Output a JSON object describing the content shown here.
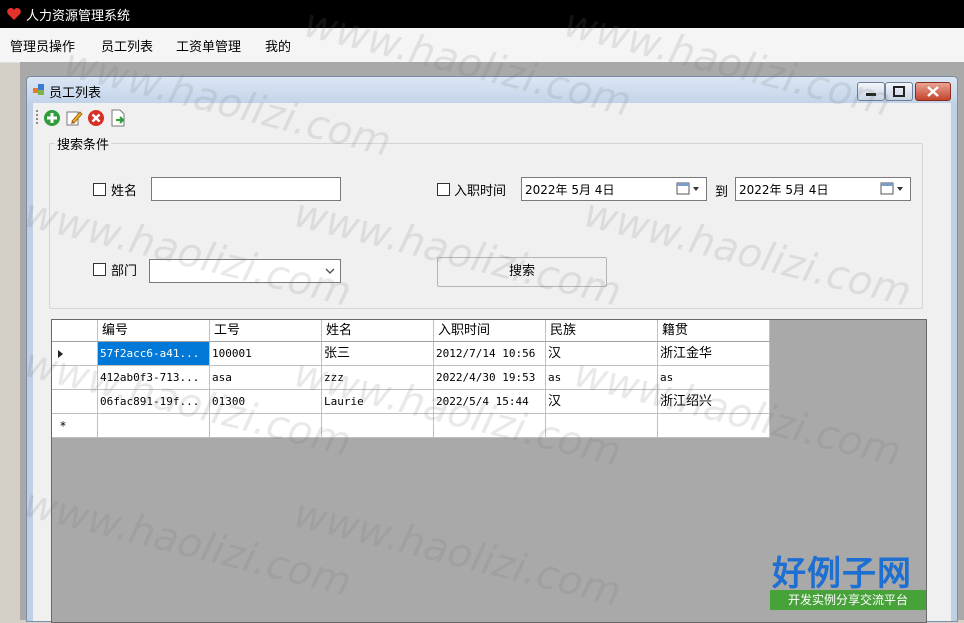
{
  "app": {
    "title": "人力资源管理系统"
  },
  "menu": {
    "items": [
      "管理员操作",
      "员工列表",
      "工资单管理",
      "我的"
    ]
  },
  "child_window": {
    "title": "员工列表"
  },
  "toolbar": {
    "icons": [
      "add-icon",
      "edit-icon",
      "delete-icon",
      "export-icon"
    ]
  },
  "search": {
    "legend": "搜索条件",
    "name_label": "姓名",
    "name_value": "",
    "hire_label": "入职时间",
    "hire_from": "2022年 5月 4日",
    "to_label": "到",
    "hire_to": "2022年 5月 4日",
    "dept_label": "部门",
    "dept_value": "",
    "button_label": "搜索"
  },
  "grid": {
    "columns": [
      "编号",
      "工号",
      "姓名",
      "入职时间",
      "民族",
      "籍贯"
    ],
    "rows": [
      [
        "57f2acc6-a41...",
        "100001",
        "张三",
        "2012/7/14 10:56",
        "汉",
        "浙江金华"
      ],
      [
        "412ab0f3-713...",
        "asa",
        "zzz",
        "2022/4/30 19:53",
        "as",
        "as"
      ],
      [
        "06fac891-19f...",
        "01300",
        "Laurie",
        "2022/5/4 15:44",
        "汉",
        "浙江绍兴"
      ]
    ],
    "new_row_marker": "*"
  },
  "watermark": {
    "text": "www.haolizi.com"
  },
  "logo": {
    "title": "好例子网",
    "subtitle": "开发实例分享交流平台"
  },
  "colors": {
    "selection": "#0078d7",
    "logo_blue": "#1d6fd1",
    "logo_green": "#48a23a"
  }
}
